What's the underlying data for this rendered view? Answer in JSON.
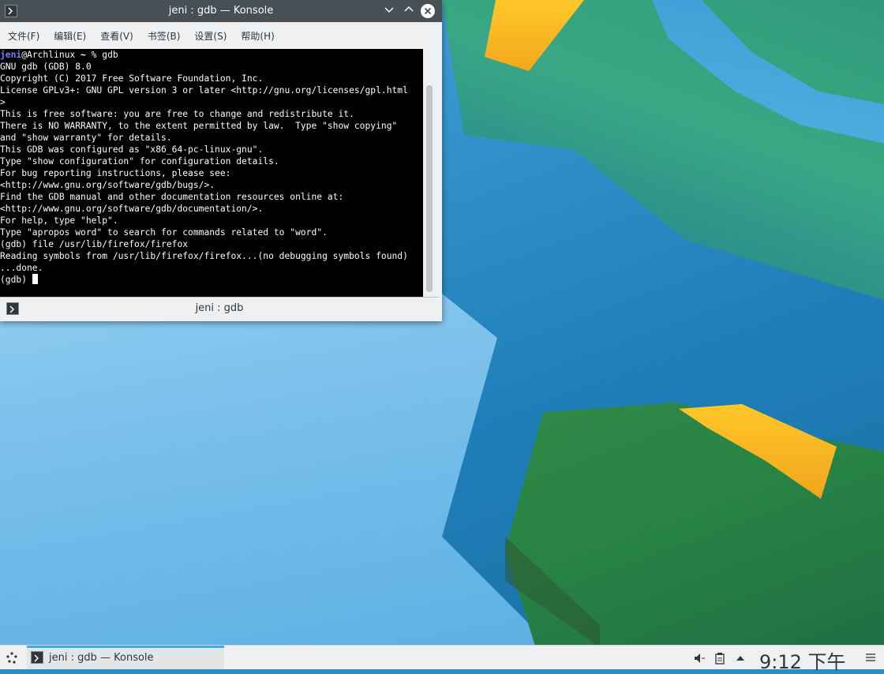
{
  "window": {
    "title": "jeni : gdb — Konsole",
    "controls": {
      "minimize": "⌄",
      "maximize": "⌃",
      "close": "✕"
    }
  },
  "menubar": {
    "items": [
      {
        "label": "文件(F)"
      },
      {
        "label": "编辑(E)"
      },
      {
        "label": "查看(V)"
      },
      {
        "label": "书签(B)"
      },
      {
        "label": "设置(S)"
      },
      {
        "label": "帮助(H)"
      }
    ]
  },
  "terminal": {
    "prompt_user": "jeni",
    "prompt_host": "@Archlinux ",
    "prompt_tilde": "~",
    "prompt_cmd": " % gdb",
    "lines": [
      "GNU gdb (GDB) 8.0",
      "Copyright (C) 2017 Free Software Foundation, Inc.",
      "License GPLv3+: GNU GPL version 3 or later <http://gnu.org/licenses/gpl.html",
      ">",
      "This is free software: you are free to change and redistribute it.",
      "There is NO WARRANTY, to the extent permitted by law.  Type \"show copying\"",
      "and \"show warranty\" for details.",
      "This GDB was configured as \"x86_64-pc-linux-gnu\".",
      "Type \"show configuration\" for configuration details.",
      "For bug reporting instructions, please see:",
      "<http://www.gnu.org/software/gdb/bugs/>.",
      "Find the GDB manual and other documentation resources online at:",
      "<http://www.gnu.org/software/gdb/documentation/>.",
      "For help, type \"help\".",
      "Type \"apropos word\" to search for commands related to \"word\".",
      "(gdb) file /usr/lib/firefox/firefox",
      "Reading symbols from /usr/lib/firefox/firefox...(no debugging symbols found)",
      "...done."
    ],
    "current_prompt": "(gdb) "
  },
  "tabbar": {
    "label": "jeni : gdb"
  },
  "panel": {
    "task_label": "jeni : gdb — Konsole",
    "clock": "9:12 下午",
    "colors": {
      "accent": "#3daee9"
    }
  }
}
